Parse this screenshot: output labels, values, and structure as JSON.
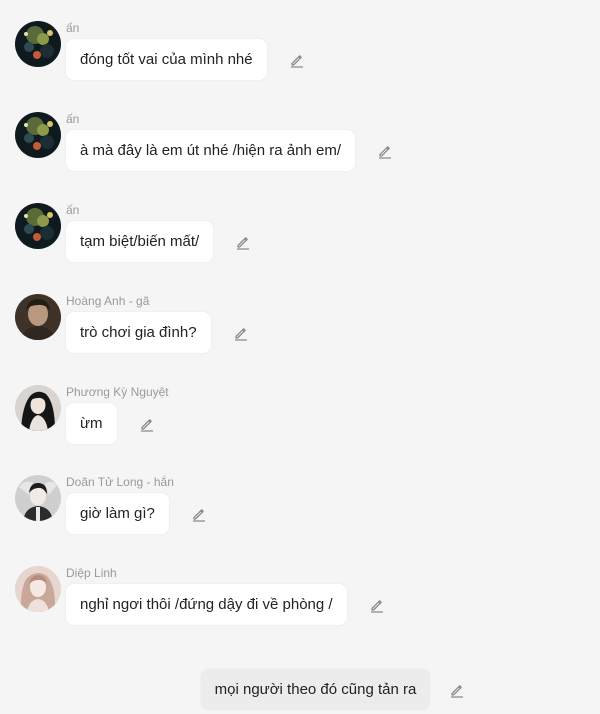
{
  "messages": [
    {
      "sender": "ấn",
      "text": "đóng tốt vai của mình nhé",
      "avatar": "avatar-an"
    },
    {
      "sender": "ấn",
      "text": "à mà đây là em út nhé /hiện ra ảnh em/",
      "avatar": "avatar-an"
    },
    {
      "sender": "ấn",
      "text": "tạm biệt/biến mất/",
      "avatar": "avatar-an"
    },
    {
      "sender": "Hoàng Anh - gã",
      "text": "trò chơi gia đình?",
      "avatar": "avatar-hoang-anh"
    },
    {
      "sender": "Phương Kỳ Nguyệt",
      "text": "ừm",
      "avatar": "avatar-phuong-ky-nguyet"
    },
    {
      "sender": "Doãn Tử Long - hắn",
      "text": "giờ làm gì?",
      "avatar": "avatar-doan-tu-long"
    },
    {
      "sender": "Diệp Linh",
      "text": "nghỉ ngơi thôi /đứng dậy đi về phòng /",
      "avatar": "avatar-diep-linh"
    }
  ],
  "narration": {
    "text": "mọi người theo đó cũng tản ra"
  },
  "icons": {
    "edit": "pencil-icon"
  },
  "colors": {
    "background": "#f5f5f5",
    "bubble": "#ffffff",
    "narration_bubble": "#ececec",
    "sender_text": "#9a9a9a",
    "icon": "#8a8a8a"
  }
}
